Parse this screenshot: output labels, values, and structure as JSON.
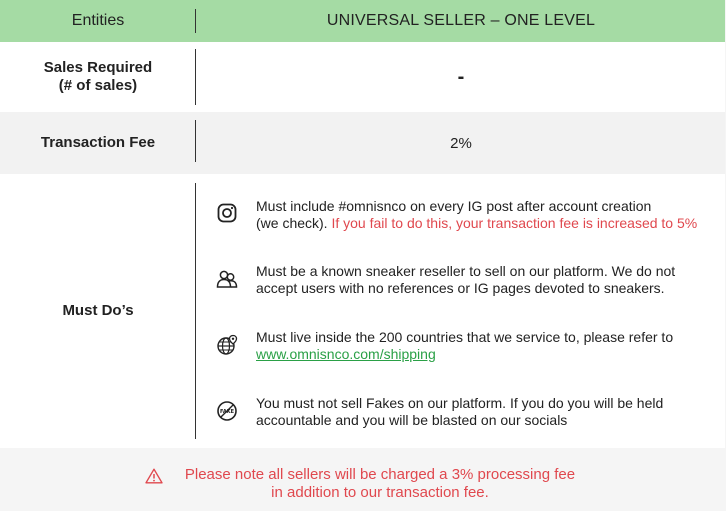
{
  "table": {
    "header": {
      "entities": "Entities",
      "plan": "UNIVERSAL SELLER – ONE LEVEL"
    },
    "sales_required": {
      "label_line1": "Sales Required",
      "label_line2": "(# of sales)",
      "value": "-"
    },
    "transaction_fee": {
      "label": "Transaction Fee",
      "value": "2%"
    },
    "must_dos": {
      "label": "Must Do’s",
      "items": [
        {
          "icon": "instagram-icon",
          "text_line1": "Must include #omnisnco on every IG post after account creation",
          "text_line2": "(we check).",
          "highlight": "If you fail to do this, your transaction fee is increased to 5%"
        },
        {
          "icon": "users-icon",
          "text_line1": "Must be a known sneaker reseller to sell on our platform. We do not",
          "text_line2": "accept users with no references or IG pages devoted to sneakers."
        },
        {
          "icon": "globe-location-icon",
          "text_line1": "Must live inside the 200 countries that we service to, please refer to",
          "link": "www.omnisnco.com/shipping"
        },
        {
          "icon": "no-fake-icon",
          "icon_text": "FAKE",
          "text_line1": "You must not sell Fakes on our platform. If you do you will be held",
          "text_line2": "accountable and you will be blasted on our socials"
        }
      ]
    }
  },
  "footer": {
    "icon": "warning-icon",
    "line1": "Please note all sellers will be charged a 3% processing fee",
    "line2": "in addition to our transaction fee."
  },
  "colors": {
    "header_bg": "#a5dba4",
    "warning": "#e0484e",
    "link": "#2aa046"
  }
}
